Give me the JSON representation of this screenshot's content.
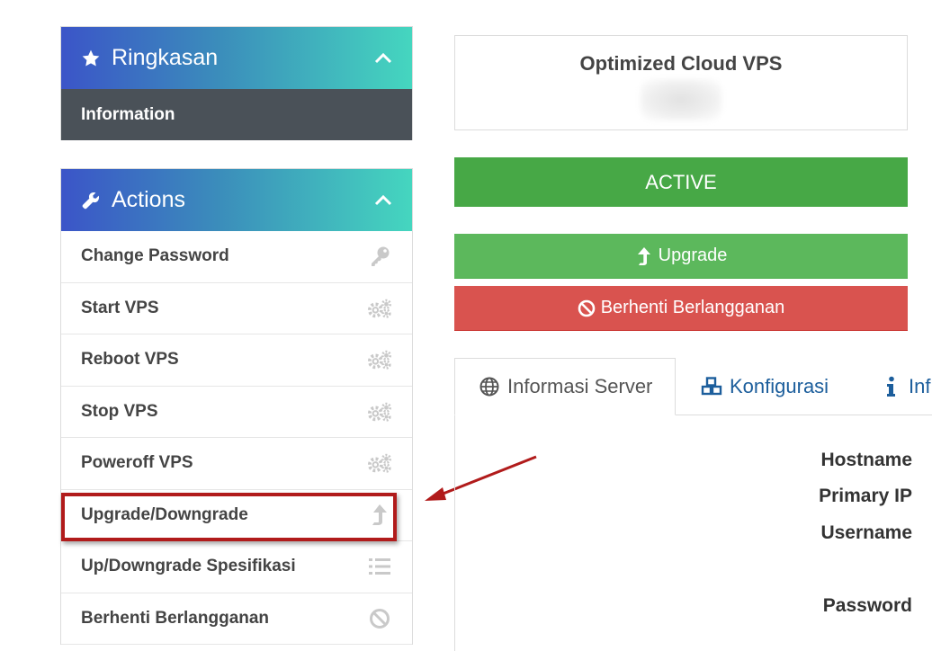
{
  "sidebar": {
    "summary": {
      "title": "Ringkasan",
      "icon": "star-icon",
      "items": [
        {
          "label": "Information"
        }
      ]
    },
    "actions": {
      "title": "Actions",
      "icon": "wrench-icon",
      "items": [
        {
          "label": "Change Password",
          "icon": "key-icon"
        },
        {
          "label": "Start VPS",
          "icon": "gears-icon"
        },
        {
          "label": "Reboot VPS",
          "icon": "gears-icon"
        },
        {
          "label": "Stop VPS",
          "icon": "gears-icon"
        },
        {
          "label": "Poweroff VPS",
          "icon": "gears-icon"
        },
        {
          "label": "Upgrade/Downgrade",
          "icon": "level-up-icon"
        },
        {
          "label": "Up/Downgrade Spesifikasi",
          "icon": "list-icon"
        },
        {
          "label": "Berhenti Berlangganan",
          "icon": "ban-icon"
        }
      ]
    }
  },
  "product": {
    "name": "Optimized Cloud VPS"
  },
  "status": {
    "label": "ACTIVE"
  },
  "buttons": {
    "upgrade": "Upgrade",
    "cancel": "Berhenti Berlangganan"
  },
  "tabs": [
    {
      "label": "Informasi Server",
      "icon": "globe-icon"
    },
    {
      "label": "Konfigurasi",
      "icon": "cubes-icon"
    },
    {
      "label": "Inf",
      "icon": "info-icon"
    }
  ],
  "server_info": {
    "hostname_label": "Hostname",
    "primary_ip_label": "Primary IP",
    "username_label": "Username",
    "password_label": "Password"
  },
  "colors": {
    "header_gradient_start": "#3b55c8",
    "header_gradient_end": "#45d6bf",
    "active_green": "#47a846",
    "upgrade_green": "#5cb85c",
    "cancel_red": "#d9534f",
    "highlight_red": "#b11b1b",
    "link_blue": "#1c5e9c"
  }
}
